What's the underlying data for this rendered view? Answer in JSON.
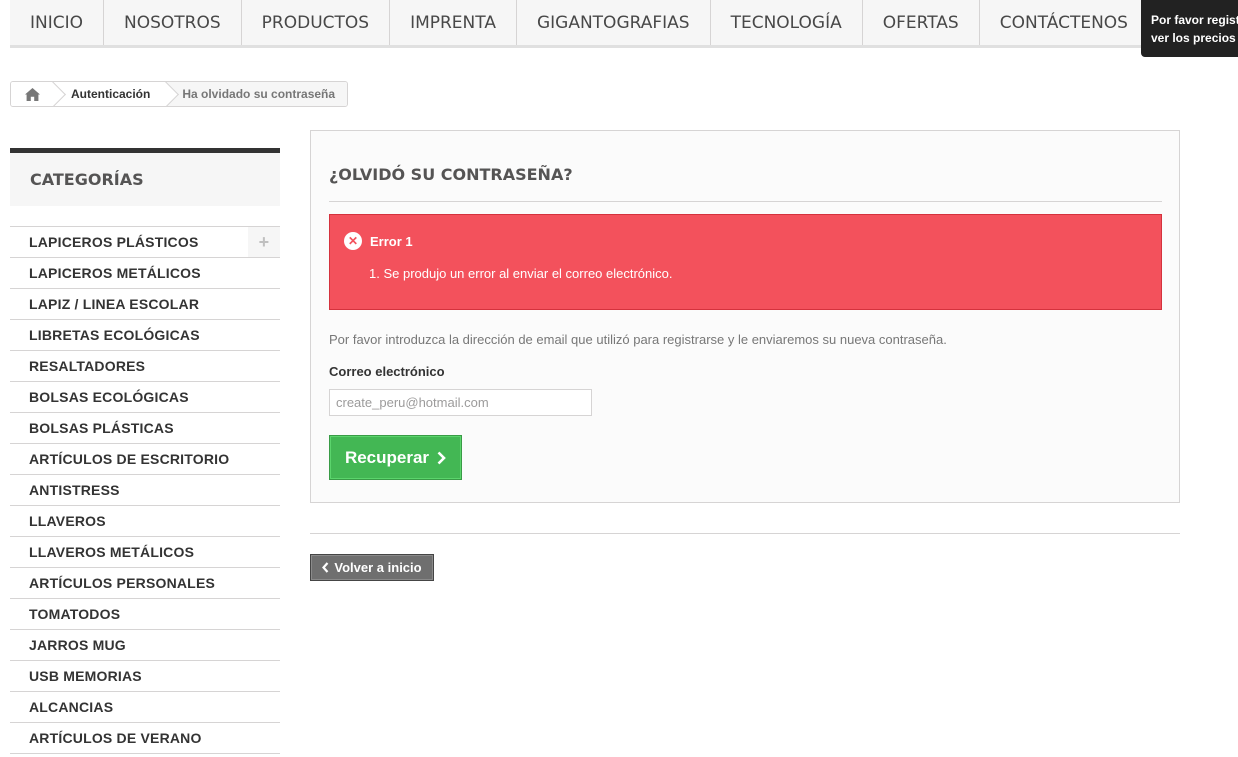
{
  "top_menu": {
    "items": [
      "INICIO",
      "NOSOTROS",
      "PRODUCTOS",
      "IMPRENTA",
      "GIGANTOGRAFIAS",
      "TECNOLOGÍA",
      "OFERTAS",
      "CONTÁCTENOS"
    ]
  },
  "tooltip": {
    "line1": "Por favor registr",
    "line2": "ver los precios"
  },
  "breadcrumb": {
    "home_icon": "home-icon",
    "link": "Autenticación",
    "current": "Ha olvidado su contraseña"
  },
  "sidebar": {
    "title": "CATEGORÍAS",
    "items": [
      "LAPICEROS PLÁSTICOS",
      "LAPICEROS METÁLICOS",
      "LAPIZ / LINEA ESCOLAR",
      "LIBRETAS ECOLÓGICAS",
      "RESALTADORES",
      "BOLSAS ECOLÓGICAS",
      "BOLSAS PLÁSTICAS",
      "ARTÍCULOS DE ESCRITORIO",
      "ANTISTRESS",
      "LLAVEROS",
      "LLAVEROS METÁLICOS",
      "ARTÍCULOS PERSONALES",
      "TOMATODOS",
      "JARROS MUG",
      "USB MEMORIAS",
      "ALCANCIAS",
      "ARTÍCULOS DE VERANO"
    ],
    "expand_symbol": "+"
  },
  "main": {
    "title": "¿OLVIDÓ SU CONTRASEÑA?",
    "error": {
      "title": "Error 1",
      "message": "1.  Se produjo un error al enviar el correo electrónico."
    },
    "intro": "Por favor introduzca la dirección de email que utilizó para registrarse y le enviaremos su nueva contraseña.",
    "email_label": "Correo electrónico",
    "email_value": "create_peru@hotmail.com",
    "submit_label": "Recuperar"
  },
  "back_label": "Volver a inicio",
  "colors": {
    "error_bg": "#f3515c",
    "success_btn": "#43b754",
    "back_btn": "#6f6f6f"
  }
}
